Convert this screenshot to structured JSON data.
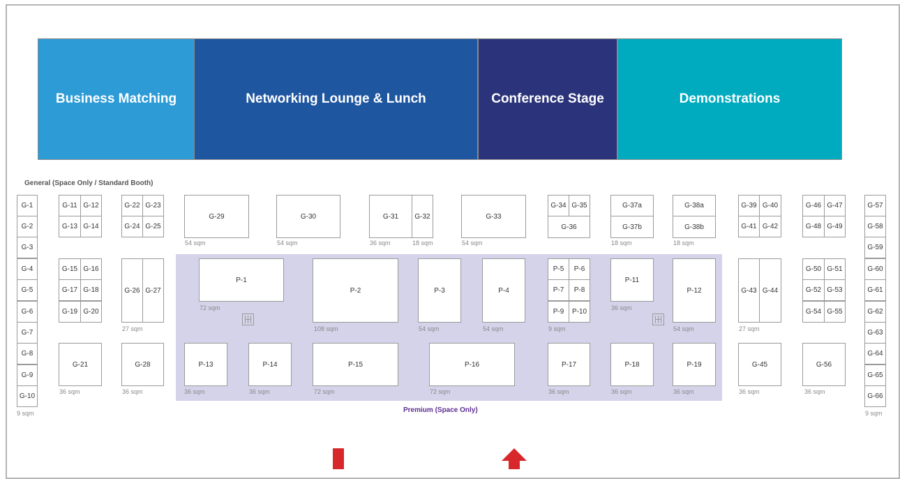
{
  "zones": {
    "business_matching": "Business Matching",
    "networking_lounge": "Networking Lounge & Lunch",
    "conference_stage": "Conference Stage",
    "demonstrations": "Demonstrations"
  },
  "general_label": "General (Space Only / Standard Booth)",
  "premium_label": "Premium (Space Only)",
  "colors": {
    "business_matching": "#2c9bd6",
    "networking_lounge": "#1f56a0",
    "conference_stage": "#2b347a",
    "demonstrations": "#00abbf",
    "premium_area": "#d4d3ea",
    "premium_label": "#5c2d91",
    "entrance_arrow": "#d7272b"
  },
  "booths": {
    "g1": "G-1",
    "g2": "G-2",
    "g3": "G-3",
    "g4": "G-4",
    "g5": "G-5",
    "g6": "G-6",
    "g7": "G-7",
    "g8": "G-8",
    "g9": "G-9",
    "g10": "G-10",
    "g11": "G-11",
    "g12": "G-12",
    "g13": "G-13",
    "g14": "G-14",
    "g15": "G-15",
    "g16": "G-16",
    "g17": "G-17",
    "g18": "G-18",
    "g19": "G-19",
    "g20": "G-20",
    "g21": "G-21",
    "g22": "G-22",
    "g23": "G-23",
    "g24": "G-24",
    "g25": "G-25",
    "g26": "G-26",
    "g27": "G-27",
    "g28": "G-28",
    "g29": "G-29",
    "g30": "G-30",
    "g31": "G-31",
    "g32": "G-32",
    "g33": "G-33",
    "g34": "G-34",
    "g35": "G-35",
    "g36": "G-36",
    "g37a": "G-37a",
    "g37b": "G-37b",
    "g38a": "G-38a",
    "g38b": "G-38b",
    "g39": "G-39",
    "g40": "G-40",
    "g41": "G-41",
    "g42": "G-42",
    "g43": "G-43",
    "g44": "G-44",
    "g45": "G-45",
    "g46": "G-46",
    "g47": "G-47",
    "g48": "G-48",
    "g49": "G-49",
    "g50": "G-50",
    "g51": "G-51",
    "g52": "G-52",
    "g53": "G-53",
    "g54": "G-54",
    "g55": "G-55",
    "g56": "G-56",
    "g57": "G-57",
    "g58": "G-58",
    "g59": "G-59",
    "g60": "G-60",
    "g61": "G-61",
    "g62": "G-62",
    "g63": "G-63",
    "g64": "G-64",
    "g65": "G-65",
    "g66": "G-66",
    "p1": "P-1",
    "p2": "P-2",
    "p3": "P-3",
    "p4": "P-4",
    "p5": "P-5",
    "p6": "P-6",
    "p7": "P-7",
    "p8": "P-8",
    "p9": "P-9",
    "p10": "P-10",
    "p11": "P-11",
    "p12": "P-12",
    "p13": "P-13",
    "p14": "P-14",
    "p15": "P-15",
    "p16": "P-16",
    "p17": "P-17",
    "p18": "P-18",
    "p19": "P-19"
  },
  "sizes": {
    "s9": "9 sqm",
    "s18": "18 sqm",
    "s27": "27 sqm",
    "s36": "36 sqm",
    "s54": "54 sqm",
    "s72": "72 sqm",
    "s108": "108 sqm"
  },
  "icons": [
    "stairs-icon",
    "entrance-arrow-icon"
  ]
}
